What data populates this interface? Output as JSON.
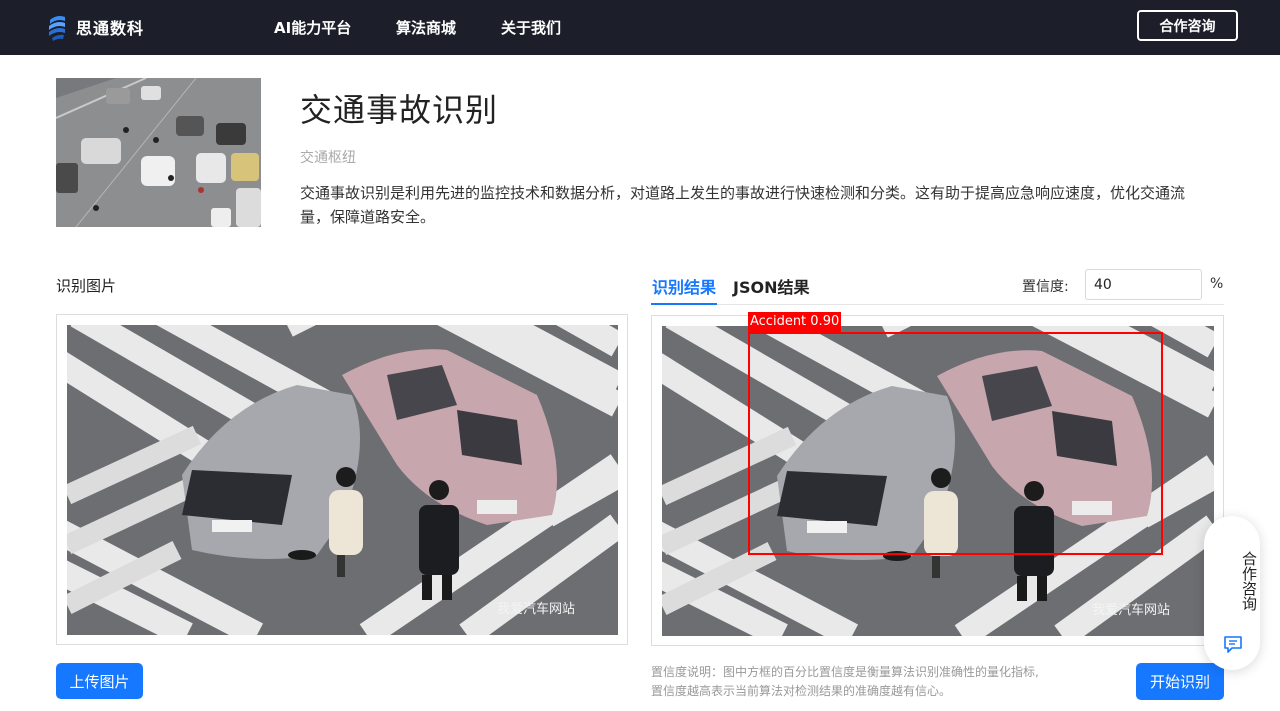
{
  "brand": {
    "name": "思通数科"
  },
  "nav": {
    "items": [
      "AI能力平台",
      "算法商城",
      "关于我们"
    ],
    "consult": "合作咨询"
  },
  "header": {
    "title": "交通事故识别",
    "category": "交通枢纽",
    "description": "交通事故识别是利用先进的监控技术和数据分析，对道路上发生的事故进行快速检测和分类。这有助于提高应急响应速度，优化交通流量，保障道路安全。"
  },
  "left": {
    "label": "识别图片",
    "upload": "上传图片",
    "watermark": "我爱汽车网站"
  },
  "right": {
    "tabs": [
      "识别结果",
      "JSON结果"
    ],
    "confidence_label": "置信度:",
    "confidence_value": "40",
    "confidence_unit": "%",
    "detection_label": "Accident 0.90",
    "note_line1": "置信度说明：图中方框的百分比置信度是衡量算法识别准确性的量化指标,",
    "note_line2": "置信度越高表示当前算法对检测结果的准确度越有信心。",
    "start": "开始识别"
  },
  "float": {
    "text": "合作咨询"
  },
  "colors": {
    "nav_bg": "#1c1f29",
    "accent": "#1677ff",
    "box": "#ff0000"
  }
}
